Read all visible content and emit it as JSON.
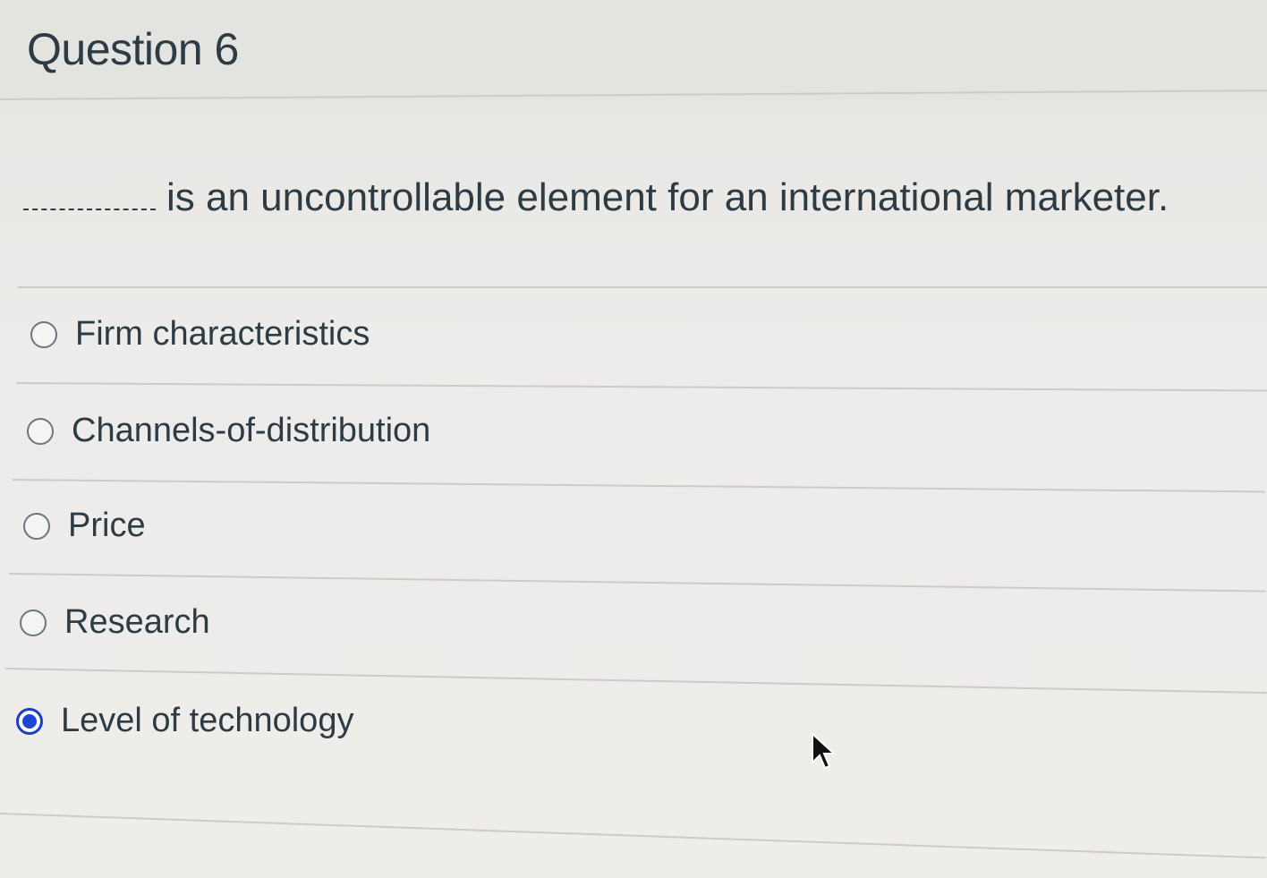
{
  "question": {
    "title": "Question 6",
    "blank": "________",
    "text": "is an uncontrollable element for an international marketer."
  },
  "options": [
    {
      "label": "Firm characteristics",
      "selected": false
    },
    {
      "label": "Channels-of-distribution",
      "selected": false
    },
    {
      "label": "Price",
      "selected": false
    },
    {
      "label": "Research",
      "selected": false
    },
    {
      "label": "Level of technology",
      "selected": true
    }
  ],
  "colors": {
    "text": "#2d3b45",
    "selected_radio": "#1f45d6",
    "background": "#eeedea"
  },
  "icons": {
    "cursor": "mouse-pointer-icon"
  }
}
